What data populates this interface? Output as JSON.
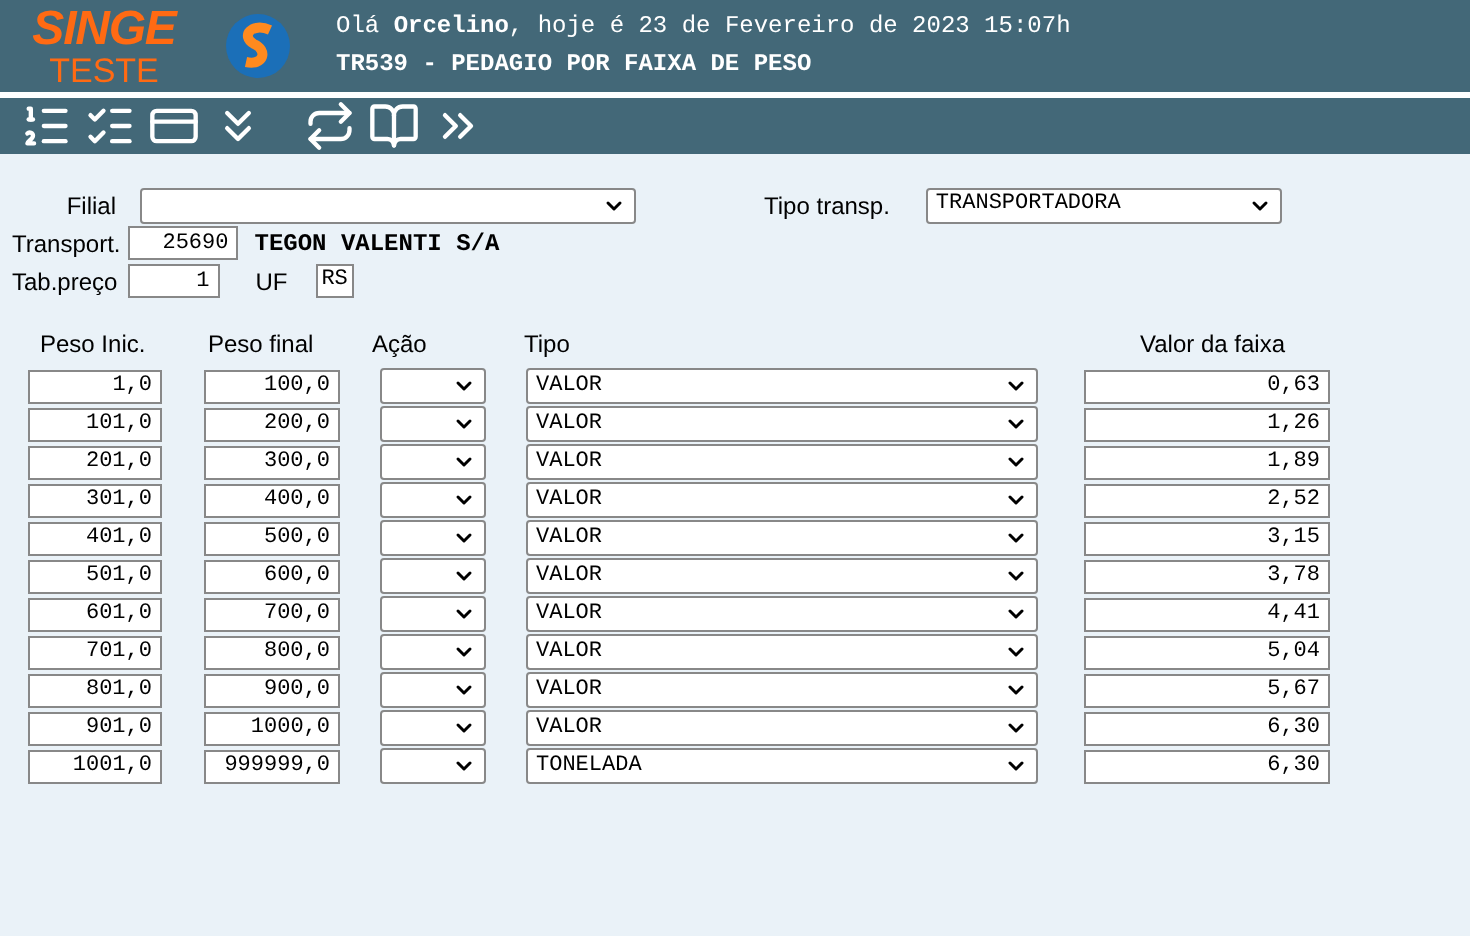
{
  "header": {
    "logo_title": "SINGE",
    "logo_subtitle": "TESTE",
    "greeting": "Olá **Orcelino**, hoje é 23 de Fevereiro de 2023 15:07h",
    "screen_title": "TR539 - PEDAGIO POR FAIXA DE PESO"
  },
  "form": {
    "filial_label": "Filial",
    "tipo_transp_label": "Tipo transp.",
    "tipo_transp_value": "TRANSPORTADORA",
    "transport_label": "Transport.",
    "transport_code": "25690",
    "transport_name": "TEGON VALENTI S/A",
    "tab_preco_label": "Tab.preço",
    "tab_preco_value": "1",
    "uf_label": "UF",
    "uf_value": "RS"
  },
  "table": {
    "columns": [
      "Peso Inic.",
      "Peso final",
      "Ação",
      "Tipo",
      "Valor da faixa"
    ],
    "rows": [
      {
        "peso_inic": "1,0",
        "peso_final": "100,0",
        "tipo": "VALOR",
        "valor": "0,63"
      },
      {
        "peso_inic": "101,0",
        "peso_final": "200,0",
        "tipo": "VALOR",
        "valor": "1,26"
      },
      {
        "peso_inic": "201,0",
        "peso_final": "300,0",
        "tipo": "VALOR",
        "valor": "1,89"
      },
      {
        "peso_inic": "301,0",
        "peso_final": "400,0",
        "tipo": "VALOR",
        "valor": "2,52"
      },
      {
        "peso_inic": "401,0",
        "peso_final": "500,0",
        "tipo": "VALOR",
        "valor": "3,15"
      },
      {
        "peso_inic": "501,0",
        "peso_final": "600,0",
        "tipo": "VALOR",
        "valor": "3,78"
      },
      {
        "peso_inic": "601,0",
        "peso_final": "700,0",
        "tipo": "VALOR",
        "valor": "4,41"
      },
      {
        "peso_inic": "701,0",
        "peso_final": "800,0",
        "tipo": "VALOR",
        "valor": "5,04"
      },
      {
        "peso_inic": "801,0",
        "peso_final": "900,0",
        "tipo": "VALOR",
        "valor": "5,67"
      },
      {
        "peso_inic": "901,0",
        "peso_final": "1000,0",
        "tipo": "VALOR",
        "valor": "6,30"
      },
      {
        "peso_inic": "1001,0",
        "peso_final": "999999,0",
        "tipo": "TONELADA",
        "valor": "6,30"
      }
    ]
  }
}
